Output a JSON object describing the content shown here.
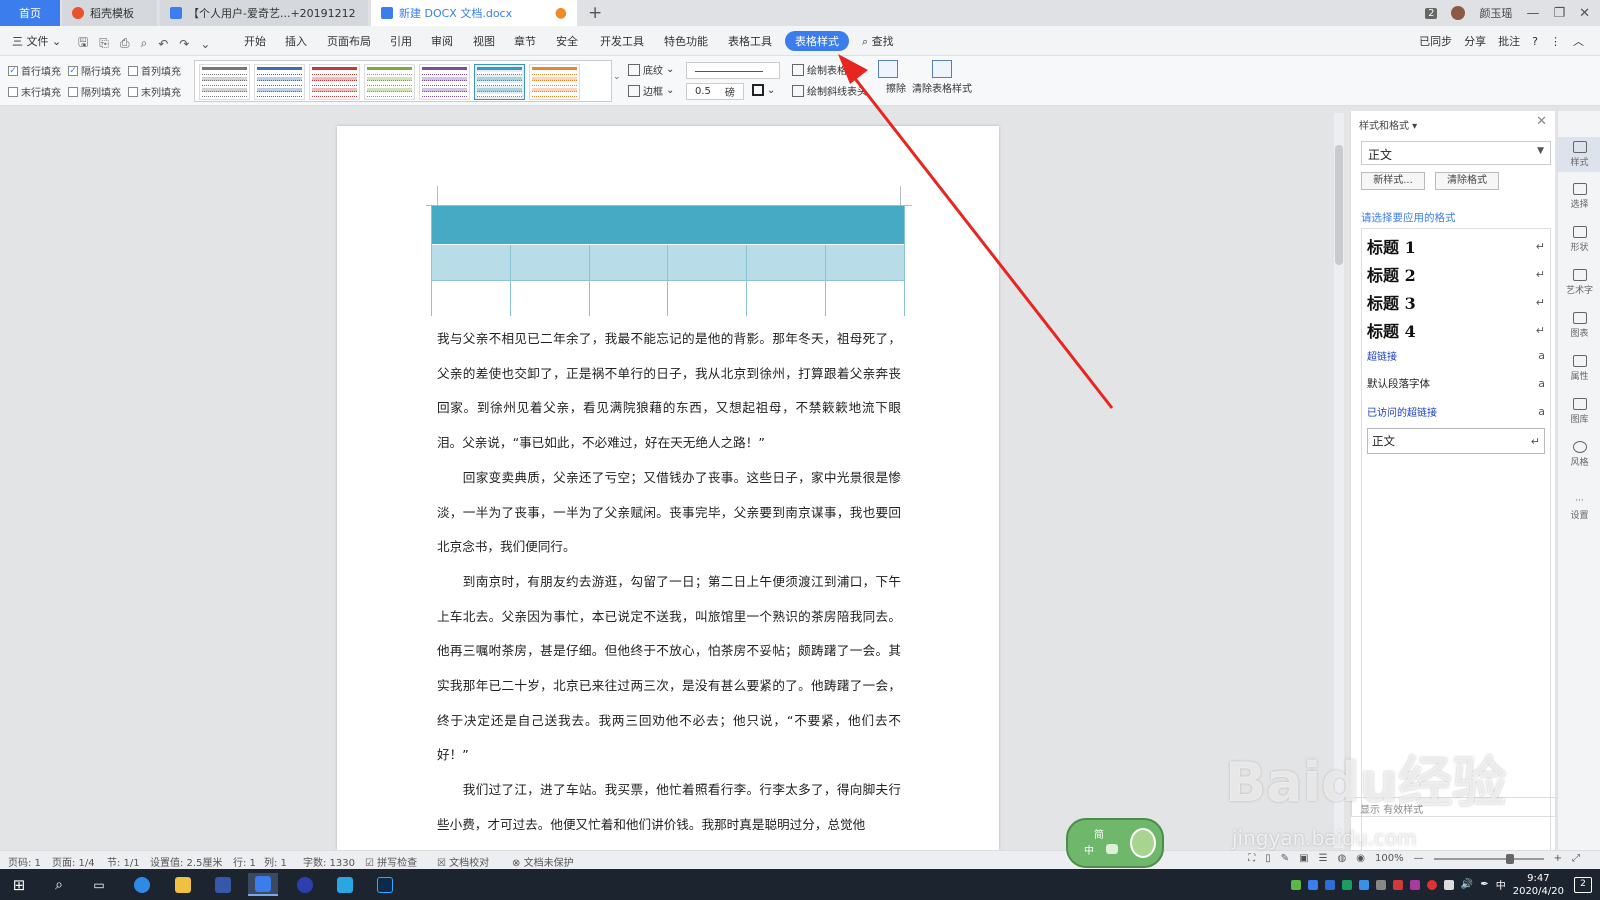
{
  "title_bar": {
    "tabs": [
      {
        "label": "首页"
      },
      {
        "label": "稻壳模板"
      },
      {
        "label": "【个人用户-爱奇艺...+20191212"
      },
      {
        "label": "新建 DOCX 文档.docx"
      }
    ],
    "new_tab": "+",
    "badge": "2",
    "user": "颜玉瑶",
    "controls": [
      "—",
      "❐",
      "✕"
    ]
  },
  "menu": {
    "file": "三 文件 ⌄",
    "items": [
      "开始",
      "插入",
      "页面布局",
      "引用",
      "审阅",
      "视图",
      "章节",
      "安全",
      "开发工具",
      "特色功能",
      "表格工具",
      "表格样式"
    ],
    "search": "查找",
    "right": [
      "已同步",
      "分享",
      "批注"
    ],
    "active": "表格样式"
  },
  "ribbon": {
    "checkboxes": [
      {
        "label": "首行填充",
        "checked": true
      },
      {
        "label": "隔行填充",
        "checked": true
      },
      {
        "label": "首列填充",
        "checked": false
      },
      {
        "label": "末行填充",
        "checked": false
      },
      {
        "label": "隔列填充",
        "checked": false
      },
      {
        "label": "末列填充",
        "checked": false
      }
    ],
    "shading": "底纹",
    "border": "边框",
    "line_width": "0.5",
    "line_width_unit": "磅",
    "draw_table": "绘制表格",
    "draw_diagonal": "绘制斜线表头",
    "erase": "擦除",
    "clear_style": "清除表格样式",
    "gallery_colors": [
      "#777777",
      "#3a6fb5",
      "#c23b3b",
      "#7ca93a",
      "#7a4fa0",
      "#3d95b8",
      "#e8852e"
    ]
  },
  "document": {
    "paragraphs": [
      "我与父亲不相见已二年余了，我最不能忘记的是他的背影。那年冬天，祖母死了，父亲的差使也交卸了，正是祸不单行的日子，我从北京到徐州，打算跟着父亲奔丧回家。到徐州见着父亲，看见满院狼藉的东西，又想起祖母，不禁簌簌地流下眼泪。父亲说，“事已如此，不必难过，好在天无绝人之路！”",
      "　　回家变卖典质，父亲还了亏空；又借钱办了丧事。这些日子，家中光景很是惨淡，一半为了丧事，一半为了父亲赋闲。丧事完毕，父亲要到南京谋事，我也要回北京念书，我们便同行。",
      "　　到南京时，有朋友约去游逛，勾留了一日；第二日上午便须渡江到浦口，下午上车北去。父亲因为事忙，本已说定不送我，叫旅馆里一个熟识的茶房陪我同去。他再三嘱咐茶房，甚是仔细。但他终于不放心，怕茶房不妥帖；颇踌躇了一会。其实我那年已二十岁，北京已来往过两三次，是没有甚么要紧的了。他踌躇了一会，终于决定还是自己送我去。我两三回劝他不必去；他只说，“不要紧，他们去不好！”",
      "　　我们过了江，进了车站。我买票，他忙着照看行李。行李太多了，得向脚夫行些小费，才可过去。他便又忙着和他们讲价钱。我那时真是聪明过分，总觉他"
    ]
  },
  "pane": {
    "title": "样式和格式 ▾",
    "close": "✕",
    "current_style": "正文",
    "new_style": "新样式...",
    "clear_format": "清除格式",
    "apply_label": "请选择要应用的格式",
    "styles": [
      {
        "name": "标题  1",
        "mark": "↵"
      },
      {
        "name": "标题  2",
        "mark": "↵"
      },
      {
        "name": "标题  3",
        "mark": "↵"
      },
      {
        "name": "标题  4",
        "mark": "↵"
      },
      {
        "name": "超链接",
        "mark": "a"
      },
      {
        "name": "默认段落字体",
        "mark": "a"
      },
      {
        "name": "已访问的超链接",
        "mark": "a"
      },
      {
        "name": "正文",
        "mark": "↵"
      }
    ],
    "bottom": "显示 有效样式"
  },
  "side_tools": [
    "样式",
    "选择",
    "形状",
    "艺术字",
    "图表",
    "属性",
    "图库",
    "风格",
    "设置"
  ],
  "status": {
    "page_code": "页码: 1",
    "page": "页面: 1/4",
    "section": "节: 1/1",
    "setting": "设置值: 2.5厘米",
    "row": "行: 1",
    "col": "列: 1",
    "words": "字数: 1330",
    "spell": "拼写检查",
    "proof": "文档校对",
    "protect": "文档未保护",
    "zoom": "100%"
  },
  "taskbar": {
    "time": "9:47",
    "date": "2020/4/20",
    "ime": "中",
    "notifications": "2"
  },
  "ime_widget": {
    "top": "简",
    "mid": "中"
  },
  "watermark": {
    "text": "Baidu经验",
    "url": "jingyan.baidu.com"
  }
}
